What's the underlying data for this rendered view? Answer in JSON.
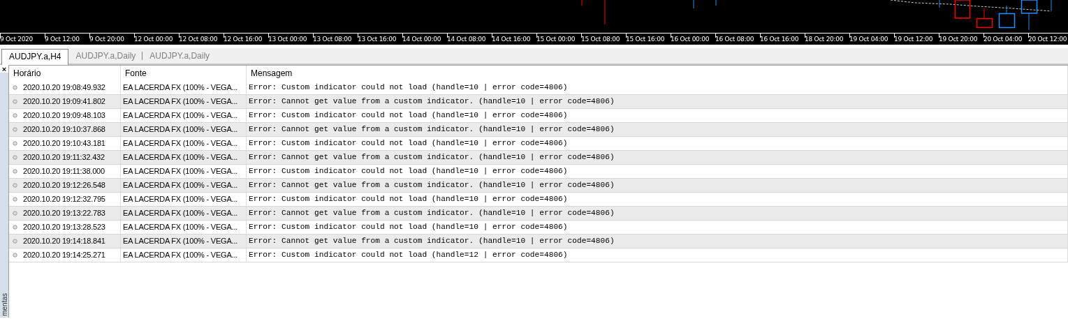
{
  "chart": {
    "time_axis": [
      "9 Oct 2020",
      "9 Oct 12:00",
      "9 Oct 20:00",
      "12 Oct 00:00",
      "12 Oct 08:00",
      "12 Oct 16:00",
      "13 Oct 00:00",
      "13 Oct 08:00",
      "13 Oct 16:00",
      "14 Oct 00:00",
      "14 Oct 08:00",
      "14 Oct 16:00",
      "15 Oct 00:00",
      "15 Oct 08:00",
      "15 Oct 16:00",
      "16 Oct 00:00",
      "16 Oct 08:00",
      "16 Oct 16:00",
      "18 Oct 20:00",
      "19 Oct 04:00",
      "19 Oct 12:00",
      "19 Oct 20:00",
      "20 Oct 04:00",
      "20 Oct 12:00"
    ]
  },
  "chart_tabs": [
    {
      "label": "AUDJPY.a,H4",
      "selected": true
    },
    {
      "label": "AUDJPY.a,Daily",
      "selected": false
    },
    {
      "label": "AUDJPY.a,Daily",
      "selected": false
    }
  ],
  "toolbox": {
    "close": "×",
    "side_label": "mentas"
  },
  "log": {
    "columns": [
      "Horário",
      "Fonte",
      "Mensagem"
    ],
    "rows": [
      [
        "2020.10.20 19:08:49.932",
        "EA LACERDA FX (100% - VEGA...",
        "Error: Custom indicator could not load (handle=10 | error code=4806)"
      ],
      [
        "2020.10.20 19:09:41.802",
        "EA LACERDA FX (100% - VEGA...",
        "Error: Cannot get value from a custom indicator. (handle=10 | error code=4806)"
      ],
      [
        "2020.10.20 19:09:48.103",
        "EA LACERDA FX (100% - VEGA...",
        "Error: Custom indicator could not load (handle=10 | error code=4806)"
      ],
      [
        "2020.10.20 19:10:37.868",
        "EA LACERDA FX (100% - VEGA...",
        "Error: Cannot get value from a custom indicator. (handle=10 | error code=4806)"
      ],
      [
        "2020.10.20 19:10:43.181",
        "EA LACERDA FX (100% - VEGA...",
        "Error: Custom indicator could not load (handle=10 | error code=4806)"
      ],
      [
        "2020.10.20 19:11:32.432",
        "EA LACERDA FX (100% - VEGA...",
        "Error: Cannot get value from a custom indicator. (handle=10 | error code=4806)"
      ],
      [
        "2020.10.20 19:11:38.000",
        "EA LACERDA FX (100% - VEGA...",
        "Error: Custom indicator could not load (handle=10 | error code=4806)"
      ],
      [
        "2020.10.20 19:12:26.548",
        "EA LACERDA FX (100% - VEGA...",
        "Error: Cannot get value from a custom indicator. (handle=10 | error code=4806)"
      ],
      [
        "2020.10.20 19:12:32.795",
        "EA LACERDA FX (100% - VEGA...",
        "Error: Custom indicator could not load (handle=10 | error code=4806)"
      ],
      [
        "2020.10.20 19:13:22.783",
        "EA LACERDA FX (100% - VEGA...",
        "Error: Cannot get value from a custom indicator. (handle=10 | error code=4806)"
      ],
      [
        "2020.10.20 19:13:28.523",
        "EA LACERDA FX (100% - VEGA...",
        "Error: Custom indicator could not load (handle=10 | error code=4806)"
      ],
      [
        "2020.10.20 19:14:18.841",
        "EA LACERDA FX (100% - VEGA...",
        "Error: Cannot get value from a custom indicator. (handle=10 | error code=4806)"
      ],
      [
        "2020.10.20 19:14:25.271",
        "EA LACERDA FX (100% - VEGA...",
        "Error: Custom indicator could not load (handle=12 | error code=4806)"
      ]
    ]
  }
}
